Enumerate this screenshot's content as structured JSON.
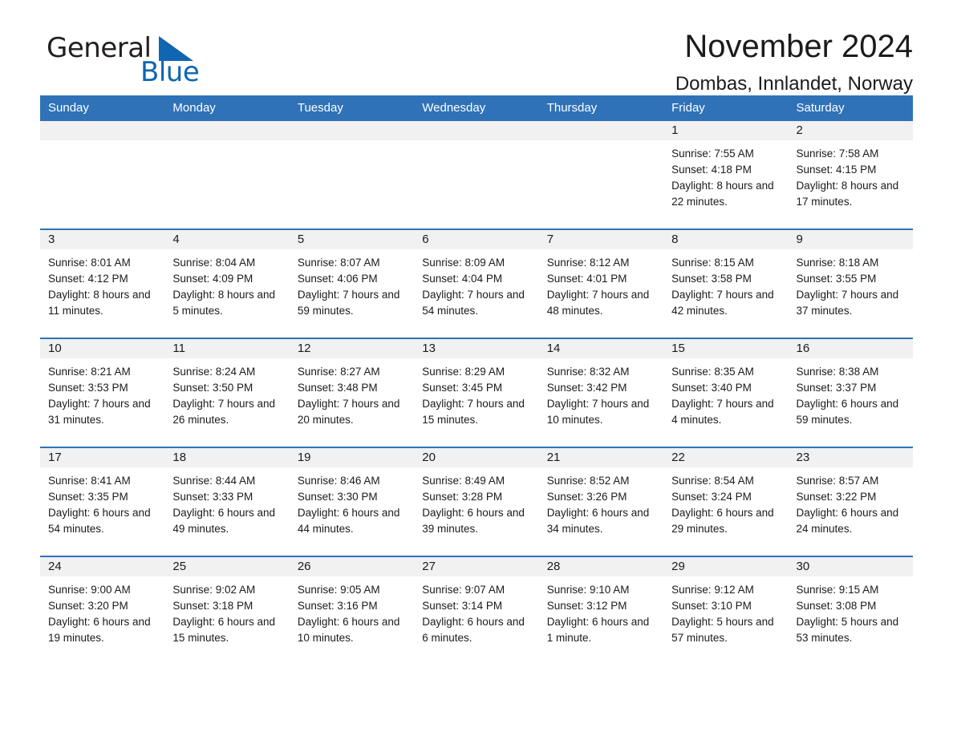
{
  "logo": {
    "word_one": "General",
    "word_two": "Blue",
    "triangle_icon": "triangle-icon",
    "accent_color": "#1066b0"
  },
  "header": {
    "title": "November 2024",
    "subtitle": "Dombas, Innlandet, Norway"
  },
  "theme": {
    "header_blue": "#2f72b8",
    "daynum_gray": "#f1f1f1",
    "text": "#1b1b1b"
  },
  "weekday_headers": [
    "Sunday",
    "Monday",
    "Tuesday",
    "Wednesday",
    "Thursday",
    "Friday",
    "Saturday"
  ],
  "weeks": [
    [
      {
        "day": "",
        "sunrise": "",
        "sunset": "",
        "daylight": ""
      },
      {
        "day": "",
        "sunrise": "",
        "sunset": "",
        "daylight": ""
      },
      {
        "day": "",
        "sunrise": "",
        "sunset": "",
        "daylight": ""
      },
      {
        "day": "",
        "sunrise": "",
        "sunset": "",
        "daylight": ""
      },
      {
        "day": "",
        "sunrise": "",
        "sunset": "",
        "daylight": ""
      },
      {
        "day": "1",
        "sunrise": "Sunrise: 7:55 AM",
        "sunset": "Sunset: 4:18 PM",
        "daylight": "Daylight: 8 hours and 22 minutes."
      },
      {
        "day": "2",
        "sunrise": "Sunrise: 7:58 AM",
        "sunset": "Sunset: 4:15 PM",
        "daylight": "Daylight: 8 hours and 17 minutes."
      }
    ],
    [
      {
        "day": "3",
        "sunrise": "Sunrise: 8:01 AM",
        "sunset": "Sunset: 4:12 PM",
        "daylight": "Daylight: 8 hours and 11 minutes."
      },
      {
        "day": "4",
        "sunrise": "Sunrise: 8:04 AM",
        "sunset": "Sunset: 4:09 PM",
        "daylight": "Daylight: 8 hours and 5 minutes."
      },
      {
        "day": "5",
        "sunrise": "Sunrise: 8:07 AM",
        "sunset": "Sunset: 4:06 PM",
        "daylight": "Daylight: 7 hours and 59 minutes."
      },
      {
        "day": "6",
        "sunrise": "Sunrise: 8:09 AM",
        "sunset": "Sunset: 4:04 PM",
        "daylight": "Daylight: 7 hours and 54 minutes."
      },
      {
        "day": "7",
        "sunrise": "Sunrise: 8:12 AM",
        "sunset": "Sunset: 4:01 PM",
        "daylight": "Daylight: 7 hours and 48 minutes."
      },
      {
        "day": "8",
        "sunrise": "Sunrise: 8:15 AM",
        "sunset": "Sunset: 3:58 PM",
        "daylight": "Daylight: 7 hours and 42 minutes."
      },
      {
        "day": "9",
        "sunrise": "Sunrise: 8:18 AM",
        "sunset": "Sunset: 3:55 PM",
        "daylight": "Daylight: 7 hours and 37 minutes."
      }
    ],
    [
      {
        "day": "10",
        "sunrise": "Sunrise: 8:21 AM",
        "sunset": "Sunset: 3:53 PM",
        "daylight": "Daylight: 7 hours and 31 minutes."
      },
      {
        "day": "11",
        "sunrise": "Sunrise: 8:24 AM",
        "sunset": "Sunset: 3:50 PM",
        "daylight": "Daylight: 7 hours and 26 minutes."
      },
      {
        "day": "12",
        "sunrise": "Sunrise: 8:27 AM",
        "sunset": "Sunset: 3:48 PM",
        "daylight": "Daylight: 7 hours and 20 minutes."
      },
      {
        "day": "13",
        "sunrise": "Sunrise: 8:29 AM",
        "sunset": "Sunset: 3:45 PM",
        "daylight": "Daylight: 7 hours and 15 minutes."
      },
      {
        "day": "14",
        "sunrise": "Sunrise: 8:32 AM",
        "sunset": "Sunset: 3:42 PM",
        "daylight": "Daylight: 7 hours and 10 minutes."
      },
      {
        "day": "15",
        "sunrise": "Sunrise: 8:35 AM",
        "sunset": "Sunset: 3:40 PM",
        "daylight": "Daylight: 7 hours and 4 minutes."
      },
      {
        "day": "16",
        "sunrise": "Sunrise: 8:38 AM",
        "sunset": "Sunset: 3:37 PM",
        "daylight": "Daylight: 6 hours and 59 minutes."
      }
    ],
    [
      {
        "day": "17",
        "sunrise": "Sunrise: 8:41 AM",
        "sunset": "Sunset: 3:35 PM",
        "daylight": "Daylight: 6 hours and 54 minutes."
      },
      {
        "day": "18",
        "sunrise": "Sunrise: 8:44 AM",
        "sunset": "Sunset: 3:33 PM",
        "daylight": "Daylight: 6 hours and 49 minutes."
      },
      {
        "day": "19",
        "sunrise": "Sunrise: 8:46 AM",
        "sunset": "Sunset: 3:30 PM",
        "daylight": "Daylight: 6 hours and 44 minutes."
      },
      {
        "day": "20",
        "sunrise": "Sunrise: 8:49 AM",
        "sunset": "Sunset: 3:28 PM",
        "daylight": "Daylight: 6 hours and 39 minutes."
      },
      {
        "day": "21",
        "sunrise": "Sunrise: 8:52 AM",
        "sunset": "Sunset: 3:26 PM",
        "daylight": "Daylight: 6 hours and 34 minutes."
      },
      {
        "day": "22",
        "sunrise": "Sunrise: 8:54 AM",
        "sunset": "Sunset: 3:24 PM",
        "daylight": "Daylight: 6 hours and 29 minutes."
      },
      {
        "day": "23",
        "sunrise": "Sunrise: 8:57 AM",
        "sunset": "Sunset: 3:22 PM",
        "daylight": "Daylight: 6 hours and 24 minutes."
      }
    ],
    [
      {
        "day": "24",
        "sunrise": "Sunrise: 9:00 AM",
        "sunset": "Sunset: 3:20 PM",
        "daylight": "Daylight: 6 hours and 19 minutes."
      },
      {
        "day": "25",
        "sunrise": "Sunrise: 9:02 AM",
        "sunset": "Sunset: 3:18 PM",
        "daylight": "Daylight: 6 hours and 15 minutes."
      },
      {
        "day": "26",
        "sunrise": "Sunrise: 9:05 AM",
        "sunset": "Sunset: 3:16 PM",
        "daylight": "Daylight: 6 hours and 10 minutes."
      },
      {
        "day": "27",
        "sunrise": "Sunrise: 9:07 AM",
        "sunset": "Sunset: 3:14 PM",
        "daylight": "Daylight: 6 hours and 6 minutes."
      },
      {
        "day": "28",
        "sunrise": "Sunrise: 9:10 AM",
        "sunset": "Sunset: 3:12 PM",
        "daylight": "Daylight: 6 hours and 1 minute."
      },
      {
        "day": "29",
        "sunrise": "Sunrise: 9:12 AM",
        "sunset": "Sunset: 3:10 PM",
        "daylight": "Daylight: 5 hours and 57 minutes."
      },
      {
        "day": "30",
        "sunrise": "Sunrise: 9:15 AM",
        "sunset": "Sunset: 3:08 PM",
        "daylight": "Daylight: 5 hours and 53 minutes."
      }
    ]
  ]
}
